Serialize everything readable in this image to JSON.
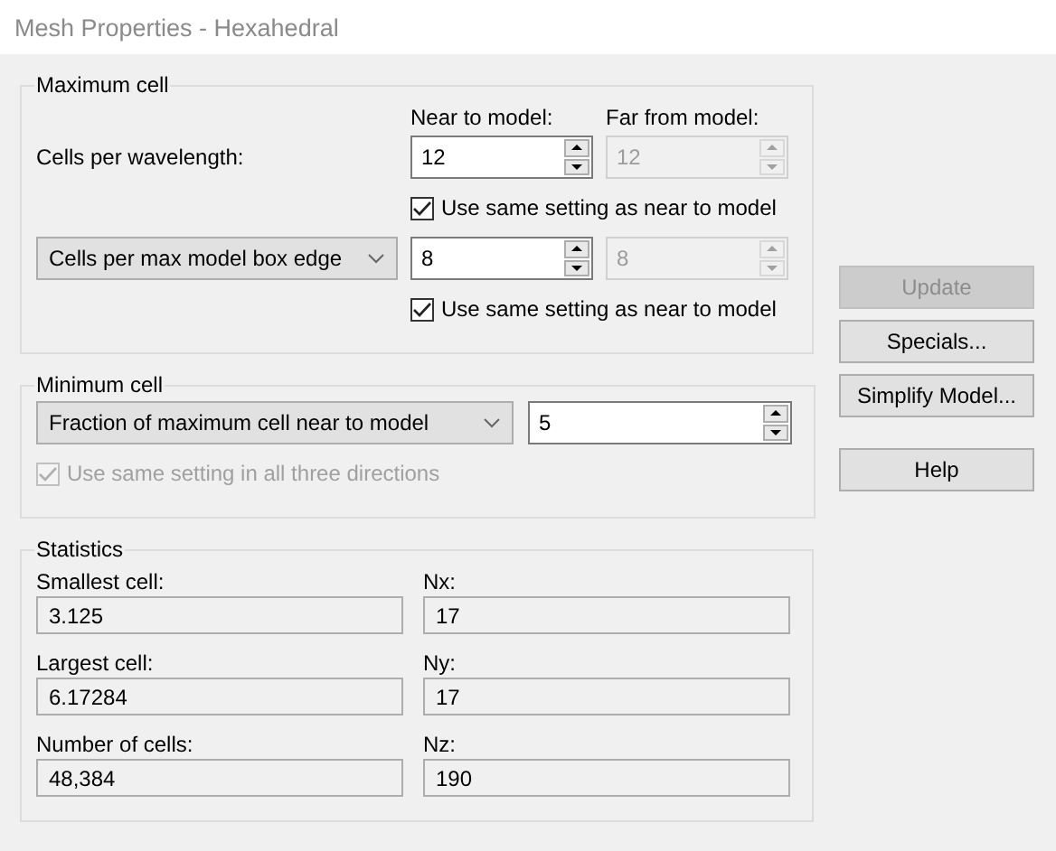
{
  "window": {
    "title": "Mesh Properties - Hexahedral"
  },
  "maximum_cell": {
    "title": "Maximum cell",
    "near_label": "Near to model:",
    "far_label": "Far from model:",
    "rows": [
      {
        "kind": "label",
        "label": "Cells per wavelength:",
        "near": "12",
        "far": "12",
        "far_disabled": true,
        "same": {
          "label": "Use same setting as near to model",
          "checked": true
        }
      },
      {
        "kind": "dropdown",
        "label": "Cells per max model box edge",
        "near": "8",
        "far": "8",
        "far_disabled": true,
        "same": {
          "label": "Use same setting as near to model",
          "checked": true
        }
      }
    ]
  },
  "minimum_cell": {
    "title": "Minimum cell",
    "dropdown": "Fraction of maximum cell near to model",
    "value": "5",
    "same": {
      "label": "Use same setting in all three directions",
      "checked": true,
      "disabled": true
    }
  },
  "statistics": {
    "title": "Statistics",
    "fields": [
      {
        "label": "Smallest cell:",
        "value": "3.125"
      },
      {
        "label": "Nx:",
        "value": "17"
      },
      {
        "label": "Largest cell:",
        "value": "6.17284"
      },
      {
        "label": "Ny:",
        "value": "17"
      },
      {
        "label": "Number of cells:",
        "value": "48,384"
      },
      {
        "label": "Nz:",
        "value": "190"
      }
    ]
  },
  "buttons": [
    {
      "label": "Update",
      "disabled": true
    },
    {
      "label": "Specials...",
      "disabled": false
    },
    {
      "label": "Simplify Model...",
      "disabled": false
    },
    {
      "label": "Help",
      "disabled": false
    }
  ]
}
